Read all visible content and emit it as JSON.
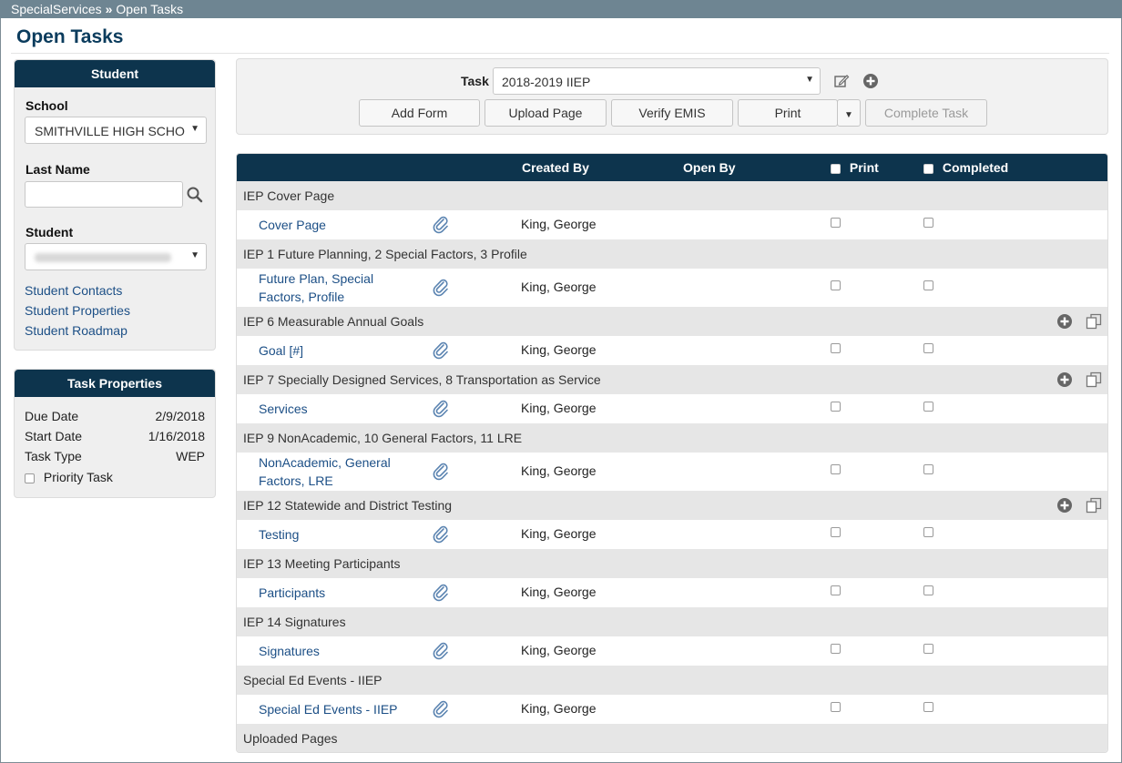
{
  "breadcrumb": {
    "root": "SpecialServices",
    "separator": "»",
    "current": "Open Tasks"
  },
  "page_title": "Open Tasks",
  "student_panel": {
    "title": "Student",
    "school_label": "School",
    "school_value": "SMITHVILLE HIGH SCHO",
    "last_name_label": "Last Name",
    "last_name_value": "",
    "student_label": "Student",
    "links": [
      "Student Contacts",
      "Student Properties",
      "Student Roadmap"
    ]
  },
  "task_properties": {
    "title": "Task Properties",
    "rows": [
      {
        "label": "Due Date",
        "value": "2/9/2018"
      },
      {
        "label": "Start Date",
        "value": "1/16/2018"
      },
      {
        "label": "Task Type",
        "value": "WEP"
      }
    ],
    "priority_label": "Priority Task",
    "priority_checked": false
  },
  "toolbar": {
    "task_label": "Task",
    "task_value": "2018-2019 IIEP",
    "buttons": {
      "add_form": "Add Form",
      "upload_page": "Upload Page",
      "verify_emis": "Verify EMIS",
      "print": "Print",
      "complete_task": "Complete Task"
    }
  },
  "grid": {
    "columns": {
      "created_by": "Created By",
      "open_by": "Open By",
      "print": "Print",
      "completed": "Completed"
    },
    "groups": [
      {
        "title": "IEP Cover Page",
        "actions": false,
        "items": [
          {
            "name": "Cover Page",
            "created_by": "King, George"
          }
        ]
      },
      {
        "title": "IEP 1 Future Planning, 2 Special Factors, 3 Profile",
        "actions": false,
        "items": [
          {
            "name": "Future Plan, Special Factors, Profile",
            "created_by": "King, George"
          }
        ]
      },
      {
        "title": "IEP 6 Measurable Annual Goals",
        "actions": true,
        "items": [
          {
            "name": "Goal [#]",
            "created_by": "King, George"
          }
        ]
      },
      {
        "title": "IEP 7 Specially Designed Services, 8 Transportation as Service",
        "actions": true,
        "items": [
          {
            "name": "Services",
            "created_by": "King, George"
          }
        ]
      },
      {
        "title": "IEP 9 NonAcademic, 10 General Factors, 11 LRE",
        "actions": false,
        "items": [
          {
            "name": "NonAcademic, General Factors, LRE",
            "created_by": "King, George"
          }
        ]
      },
      {
        "title": "IEP 12 Statewide and District Testing",
        "actions": true,
        "items": [
          {
            "name": "Testing",
            "created_by": "King, George"
          }
        ]
      },
      {
        "title": "IEP 13 Meeting Participants",
        "actions": false,
        "items": [
          {
            "name": "Participants",
            "created_by": "King, George"
          }
        ]
      },
      {
        "title": "IEP 14 Signatures",
        "actions": false,
        "items": [
          {
            "name": "Signatures",
            "created_by": "King, George"
          }
        ]
      },
      {
        "title": "Special Ed Events - IIEP",
        "actions": false,
        "items": [
          {
            "name": "Special Ed Events - IIEP",
            "created_by": "King, George"
          }
        ]
      },
      {
        "title": "Uploaded Pages",
        "actions": false,
        "items": []
      }
    ]
  }
}
